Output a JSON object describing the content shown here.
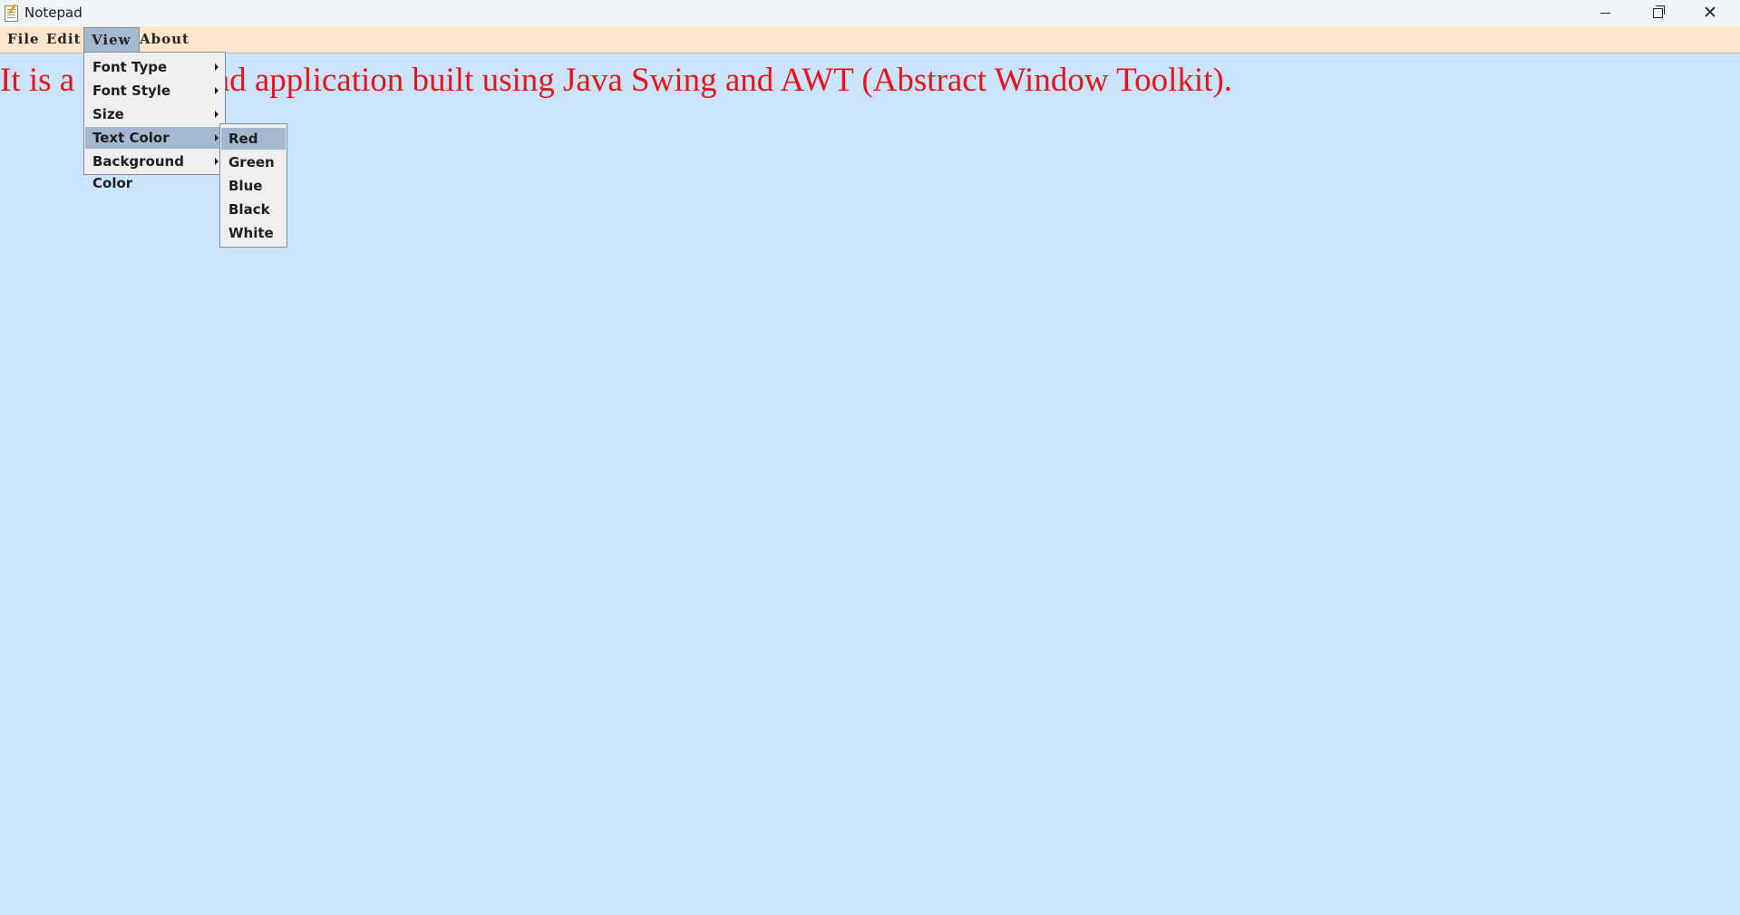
{
  "window": {
    "title": "Notepad",
    "icon": "notepad-icon",
    "controls": [
      "minimize-icon",
      "restore-icon",
      "close-icon"
    ]
  },
  "menubar": {
    "items": [
      {
        "label": "File"
      },
      {
        "label": "Edit"
      },
      {
        "label": "View"
      },
      {
        "label": "About"
      }
    ]
  },
  "editor": {
    "text": "It is a simple notepad application built using Java Swing and AWT (Abstract Window Toolkit).",
    "visible_text_before_menu": "It is a",
    "visible_text_after_menu": "pad application built using Java Swing and AWT (Abstract Window Toolkit).",
    "text_color": "#e8141c",
    "background_color": "#cce4fb"
  },
  "view_menu": {
    "items": [
      {
        "label": "Font Type"
      },
      {
        "label": "Font Style"
      },
      {
        "label": "Size"
      },
      {
        "label": "Text Color"
      },
      {
        "label": "Background Color"
      }
    ]
  },
  "text_color_submenu": {
    "items": [
      {
        "label": "Red"
      },
      {
        "label": "Green"
      },
      {
        "label": "Blue"
      },
      {
        "label": "Black"
      },
      {
        "label": "White"
      }
    ]
  },
  "colors": {
    "menubar_bg": "#fde4cb",
    "highlight": "#a4b8cf",
    "menu_bg": "#efefef"
  }
}
